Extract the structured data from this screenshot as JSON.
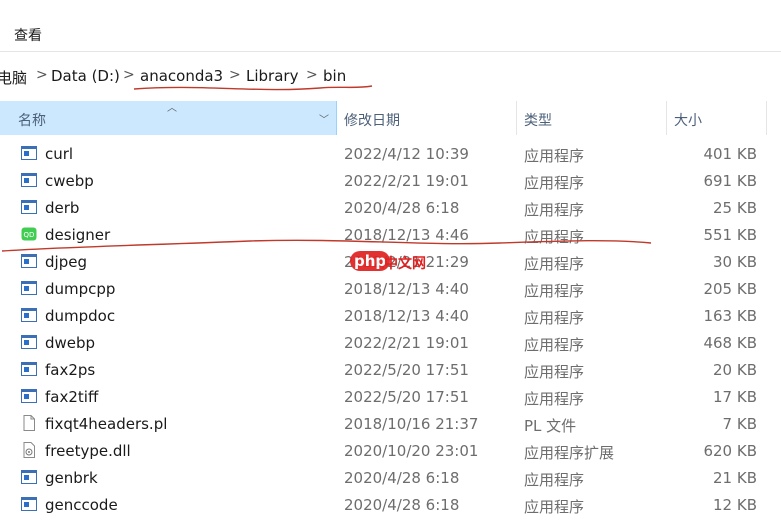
{
  "ribbon": {
    "view_tab": "查看"
  },
  "breadcrumb": {
    "items": [
      "电脑",
      "Data (D:)",
      "anaconda3",
      "Library",
      "bin"
    ],
    "separator": ">"
  },
  "columns": {
    "name": "名称",
    "date": "修改日期",
    "type": "类型",
    "size": "大小"
  },
  "files": [
    {
      "name": "curl",
      "date": "2022/4/12 10:39",
      "type": "应用程序",
      "size": "401 KB",
      "icon": "exe-icon"
    },
    {
      "name": "cwebp",
      "date": "2022/2/21 19:01",
      "type": "应用程序",
      "size": "691 KB",
      "icon": "exe-icon"
    },
    {
      "name": "derb",
      "date": "2020/4/28 6:18",
      "type": "应用程序",
      "size": "25 KB",
      "icon": "exe-icon"
    },
    {
      "name": "designer",
      "date": "2018/12/13 4:46",
      "type": "应用程序",
      "size": "551 KB",
      "icon": "qt-designer-icon"
    },
    {
      "name": "djpeg",
      "date": "2022/2/21 21:29",
      "type": "应用程序",
      "size": "30 KB",
      "icon": "exe-icon"
    },
    {
      "name": "dumpcpp",
      "date": "2018/12/13 4:40",
      "type": "应用程序",
      "size": "205 KB",
      "icon": "exe-icon"
    },
    {
      "name": "dumpdoc",
      "date": "2018/12/13 4:40",
      "type": "应用程序",
      "size": "163 KB",
      "icon": "exe-icon"
    },
    {
      "name": "dwebp",
      "date": "2022/2/21 19:01",
      "type": "应用程序",
      "size": "468 KB",
      "icon": "exe-icon"
    },
    {
      "name": "fax2ps",
      "date": "2022/5/20 17:51",
      "type": "应用程序",
      "size": "20 KB",
      "icon": "exe-icon"
    },
    {
      "name": "fax2tiff",
      "date": "2022/5/20 17:51",
      "type": "应用程序",
      "size": "17 KB",
      "icon": "exe-icon"
    },
    {
      "name": "fixqt4headers.pl",
      "date": "2018/10/16 21:37",
      "type": "PL 文件",
      "size": "7 KB",
      "icon": "file-icon"
    },
    {
      "name": "freetype.dll",
      "date": "2020/10/20 23:01",
      "type": "应用程序扩展",
      "size": "620 KB",
      "icon": "dll-icon"
    },
    {
      "name": "genbrk",
      "date": "2020/4/28 6:18",
      "type": "应用程序",
      "size": "21 KB",
      "icon": "exe-icon"
    },
    {
      "name": "genccode",
      "date": "2020/4/28 6:18",
      "type": "应用程序",
      "size": "12 KB",
      "icon": "exe-icon"
    }
  ],
  "watermark": {
    "badge": "php",
    "text": "中文网"
  },
  "colors": {
    "selected_header": "#cce8ff",
    "annotation_red": "#c0392b",
    "exe_blue": "#2a6fc9"
  }
}
